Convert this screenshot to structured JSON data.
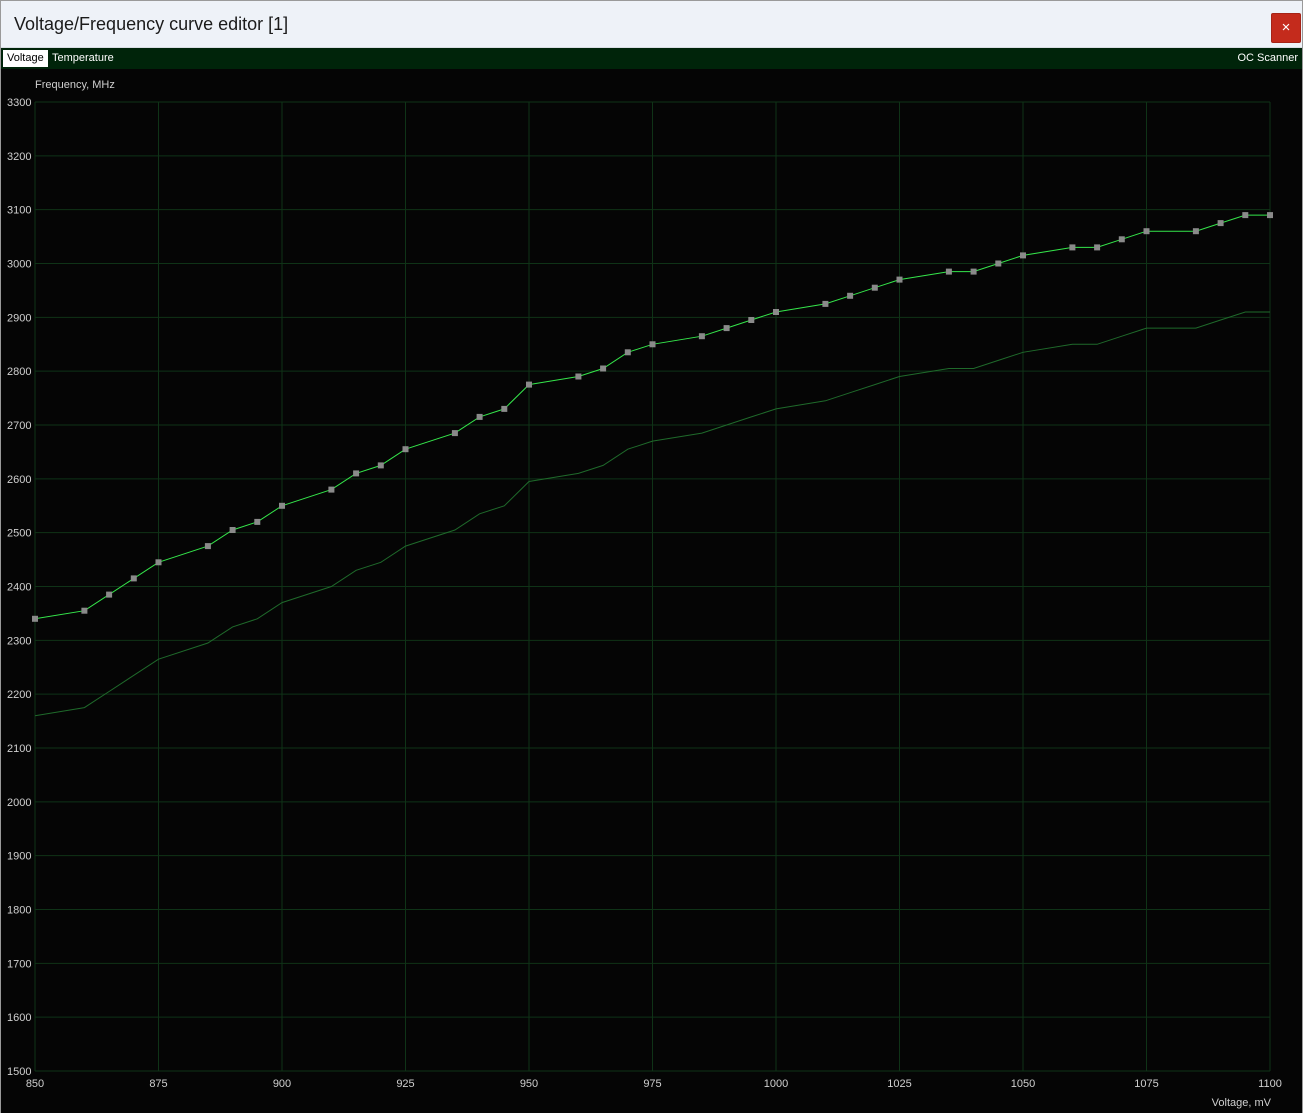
{
  "window": {
    "title": "Voltage/Frequency curve editor [1]",
    "close_glyph": "×"
  },
  "tabs": {
    "voltage": "Voltage",
    "temperature": "Temperature",
    "oc_scanner": "OC Scanner"
  },
  "colors": {
    "title_bar": "#eef2f8",
    "close_button": "#c42b1c",
    "tab_bar": "#00240a",
    "chart_background": "#050505",
    "grid": "#0f3317",
    "curve_main": "#35e64b",
    "curve_base": "#1f6a2b",
    "point_marker": "#8a8a8a"
  },
  "icons": {
    "close": "close-icon"
  },
  "chart_data": {
    "type": "line",
    "ylabel": "Frequency, MHz",
    "xlabel": "Voltage, mV",
    "xlim": [
      850,
      1100
    ],
    "ylim": [
      1500,
      3300
    ],
    "x_ticks": [
      850,
      875,
      900,
      925,
      950,
      975,
      1000,
      1025,
      1050,
      1075,
      1100
    ],
    "y_ticks": [
      1500,
      1600,
      1700,
      1800,
      1900,
      2000,
      2100,
      2200,
      2300,
      2400,
      2500,
      2600,
      2700,
      2800,
      2900,
      3000,
      3100,
      3200,
      3300
    ],
    "grid": true,
    "series": [
      {
        "role": "curve",
        "markers": true,
        "x": [
          850,
          860,
          865,
          870,
          875,
          885,
          890,
          895,
          900,
          910,
          915,
          920,
          925,
          935,
          940,
          945,
          950,
          960,
          965,
          970,
          975,
          985,
          990,
          995,
          1000,
          1010,
          1015,
          1020,
          1025,
          1035,
          1040,
          1045,
          1050,
          1060,
          1065,
          1070,
          1075,
          1085,
          1090,
          1095,
          1100
        ],
        "y": [
          2340,
          2355,
          2385,
          2415,
          2445,
          2475,
          2505,
          2520,
          2550,
          2580,
          2610,
          2625,
          2655,
          2685,
          2715,
          2730,
          2775,
          2790,
          2805,
          2835,
          2850,
          2865,
          2880,
          2895,
          2910,
          2925,
          2940,
          2955,
          2970,
          2985,
          2985,
          3000,
          3015,
          3030,
          3030,
          3045,
          3060,
          3060,
          3075,
          3090,
          3090
        ]
      },
      {
        "role": "base",
        "markers": false,
        "x": [
          850,
          860,
          865,
          870,
          875,
          885,
          890,
          895,
          900,
          910,
          915,
          920,
          925,
          935,
          940,
          945,
          950,
          960,
          965,
          970,
          975,
          985,
          990,
          995,
          1000,
          1010,
          1015,
          1020,
          1025,
          1035,
          1040,
          1045,
          1050,
          1060,
          1065,
          1070,
          1075,
          1085,
          1090,
          1095,
          1100
        ],
        "y": [
          2160,
          2175,
          2205,
          2235,
          2265,
          2295,
          2325,
          2340,
          2370,
          2400,
          2430,
          2445,
          2475,
          2505,
          2535,
          2550,
          2595,
          2610,
          2625,
          2655,
          2670,
          2685,
          2700,
          2715,
          2730,
          2745,
          2760,
          2775,
          2790,
          2805,
          2805,
          2820,
          2835,
          2850,
          2850,
          2865,
          2880,
          2880,
          2895,
          2910,
          2910
        ]
      }
    ]
  }
}
